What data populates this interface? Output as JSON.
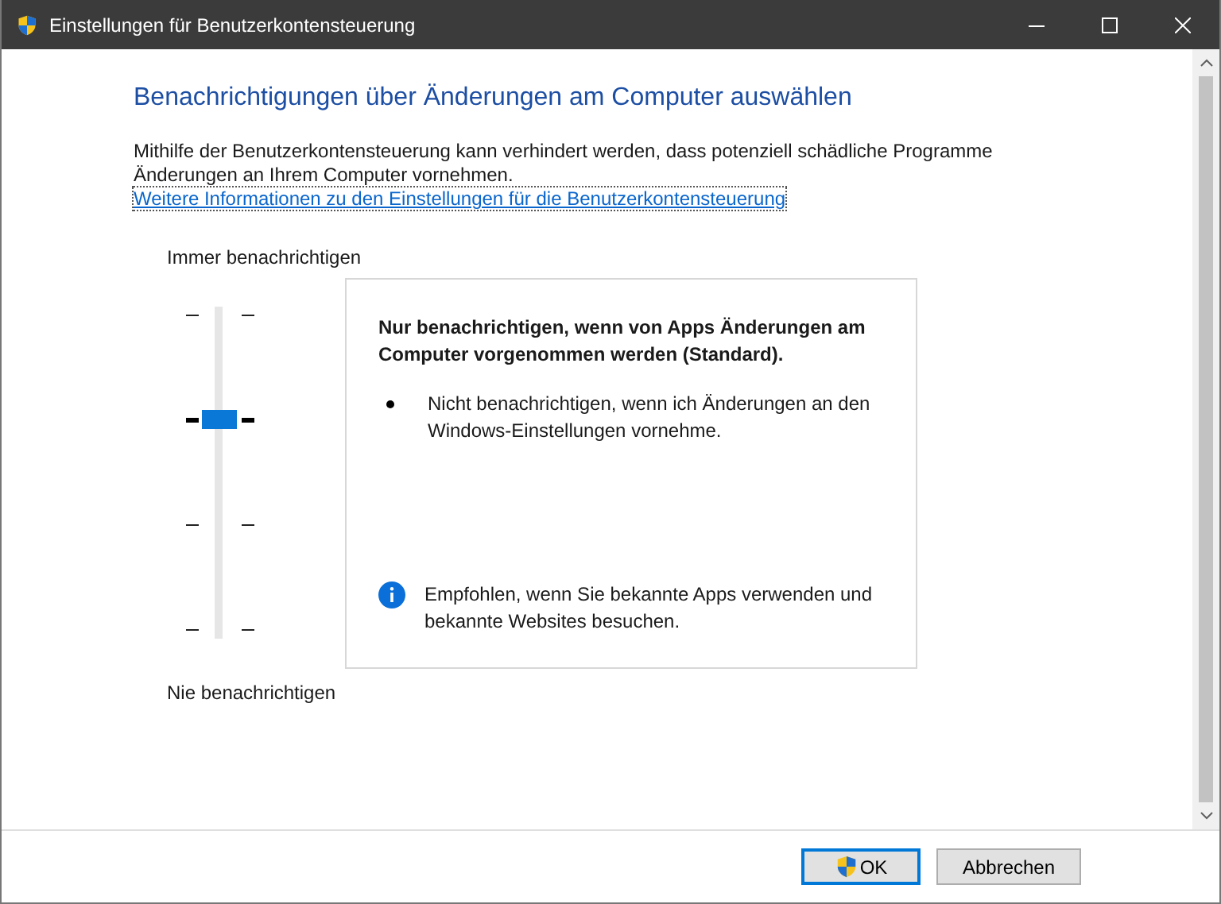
{
  "window": {
    "title": "Einstellungen für Benutzerkontensteuerung"
  },
  "heading": "Benachrichtigungen über Änderungen am Computer auswählen",
  "intro": "Mithilfe der Benutzerkontensteuerung kann verhindert werden, dass potenziell schädliche Programme Änderungen an Ihrem Computer vornehmen.",
  "link": "Weitere Informationen zu den Einstellungen für die Benutzerkontensteuerung",
  "slider": {
    "top_label": "Immer benachrichtigen",
    "bottom_label": "Nie benachrichtigen",
    "level": 0.667
  },
  "description": {
    "title": "Nur benachrichtigen, wenn von Apps Änderungen am Computer vorgenommen werden (Standard).",
    "bullets": [
      "Nicht benachrichtigen, wenn ich Änderungen an den Windows-Einstellungen vornehme."
    ],
    "info": "Empfohlen, wenn Sie bekannte Apps verwenden und bekannte Websites besuchen."
  },
  "buttons": [
    {
      "label": "OK",
      "default": true,
      "kind": "elevated"
    },
    {
      "label": "Abbrechen",
      "default": false,
      "kind": "plain"
    }
  ]
}
